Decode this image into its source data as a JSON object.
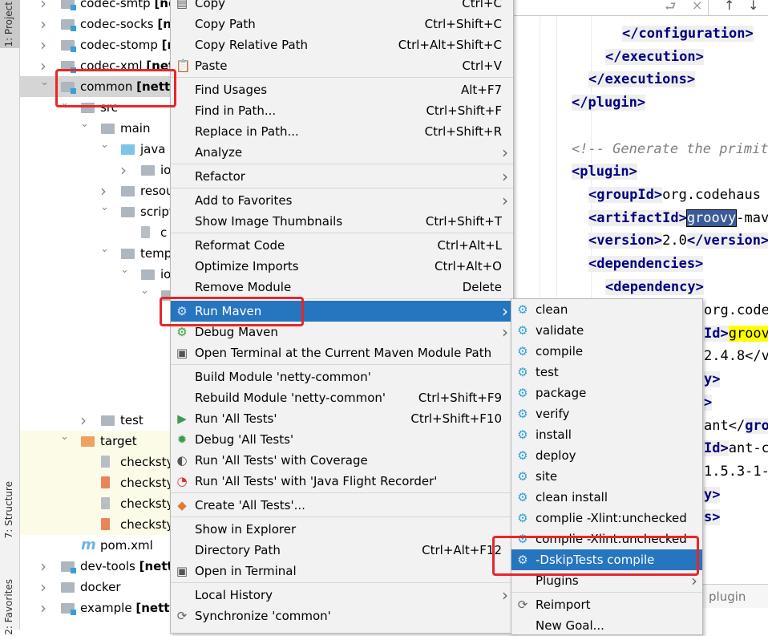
{
  "tool_windows": {
    "project": "1: Project",
    "structure": "7: Structure",
    "favorites": "2: Favorites"
  },
  "tree": [
    {
      "row": 0,
      "indent": 0,
      "chev": "right",
      "icon": "module-folder",
      "name": "codec-smtp",
      "tag": "[netty-codec-smtp]"
    },
    {
      "row": 1,
      "indent": 0,
      "chev": "right",
      "icon": "module-folder",
      "name": "codec-socks",
      "tag": "[netty-codec-socks]"
    },
    {
      "row": 2,
      "indent": 0,
      "chev": "right",
      "icon": "module-folder",
      "name": "codec-stomp",
      "tag": "[netty-codec-stomp]"
    },
    {
      "row": 3,
      "indent": 0,
      "chev": "right",
      "icon": "module-folder",
      "name": "codec-xml",
      "tag": "[netty-codec-xml]"
    },
    {
      "row": 4,
      "indent": 0,
      "chev": "down",
      "icon": "module-folder",
      "name": "common",
      "tag": "[netty-common]",
      "selected": true
    },
    {
      "row": 5,
      "indent": 1,
      "chev": "down",
      "icon": "folder",
      "name": "src"
    },
    {
      "row": 6,
      "indent": 2,
      "chev": "down",
      "icon": "folder",
      "name": "main"
    },
    {
      "row": 7,
      "indent": 3,
      "chev": "down",
      "icon": "source-folder",
      "name": "java"
    },
    {
      "row": 8,
      "indent": 4,
      "chev": "right",
      "icon": "package",
      "name": "io"
    },
    {
      "row": 9,
      "indent": 3,
      "chev": "right",
      "icon": "resources-folder",
      "name": "resources"
    },
    {
      "row": 10,
      "indent": 3,
      "chev": "down",
      "icon": "folder",
      "name": "script"
    },
    {
      "row": 11,
      "indent": 4,
      "chev": "",
      "icon": "groovy-file",
      "name": "c"
    },
    {
      "row": 12,
      "indent": 3,
      "chev": "down",
      "icon": "folder",
      "name": "templates"
    },
    {
      "row": 13,
      "indent": 4,
      "chev": "down",
      "icon": "package",
      "name": "io"
    },
    {
      "row": 14,
      "indent": 5,
      "chev": "down",
      "icon": "folder",
      "name": ""
    },
    {
      "row": 20,
      "indent": 2,
      "chev": "right",
      "icon": "folder",
      "name": "test"
    },
    {
      "row": 21,
      "indent": 1,
      "chev": "down",
      "icon": "excluded-folder",
      "name": "target",
      "yellow": true
    },
    {
      "row": 22,
      "indent": 2,
      "chev": "",
      "icon": "text-file",
      "name": "checkstyle",
      "yellow": true
    },
    {
      "row": 23,
      "indent": 2,
      "chev": "",
      "icon": "xml-file",
      "name": "checkstyle",
      "yellow": true
    },
    {
      "row": 24,
      "indent": 2,
      "chev": "",
      "icon": "text-file",
      "name": "checkstyle",
      "yellow": true
    },
    {
      "row": 25,
      "indent": 2,
      "chev": "",
      "icon": "xml-file",
      "name": "checkstyle",
      "yellow": true
    },
    {
      "row": 26,
      "indent": 1,
      "chev": "",
      "icon": "maven-file",
      "name": "pom.xml"
    },
    {
      "row": 27,
      "indent": 0,
      "chev": "right",
      "icon": "module-folder",
      "name": "dev-tools",
      "tag": "[netty-dev-tools]"
    },
    {
      "row": 28,
      "indent": 0,
      "chev": "right",
      "icon": "folder",
      "name": "docker"
    },
    {
      "row": 29,
      "indent": 0,
      "chev": "right",
      "icon": "module-folder",
      "name": "example",
      "tag": "[netty-example]"
    }
  ],
  "context_menu": [
    {
      "label": "Copy",
      "shortcut": "Ctrl+C",
      "icon": "copy-icon"
    },
    {
      "label": "Copy Path",
      "shortcut": "Ctrl+Shift+C"
    },
    {
      "label": "Copy Relative Path",
      "shortcut": "Ctrl+Alt+Shift+C"
    },
    {
      "label": "Paste",
      "shortcut": "Ctrl+V",
      "icon": "paste-icon"
    },
    {
      "sep": true
    },
    {
      "label": "Find Usages",
      "shortcut": "Alt+F7"
    },
    {
      "label": "Find in Path...",
      "shortcut": "Ctrl+Shift+F"
    },
    {
      "label": "Replace in Path...",
      "shortcut": "Ctrl+Shift+R"
    },
    {
      "label": "Analyze",
      "submenu": true
    },
    {
      "sep": true
    },
    {
      "label": "Refactor",
      "submenu": true
    },
    {
      "sep": true
    },
    {
      "label": "Add to Favorites",
      "submenu": true
    },
    {
      "label": "Show Image Thumbnails",
      "shortcut": "Ctrl+Shift+T"
    },
    {
      "sep": true
    },
    {
      "label": "Reformat Code",
      "shortcut": "Ctrl+Alt+L"
    },
    {
      "label": "Optimize Imports",
      "shortcut": "Ctrl+Alt+O"
    },
    {
      "label": "Remove Module",
      "shortcut": "Delete"
    },
    {
      "sep": true
    },
    {
      "label": "Run Maven",
      "submenu": true,
      "icon": "maven-gear-icon",
      "highlighted": true
    },
    {
      "label": "Debug Maven",
      "submenu": true,
      "icon": "maven-debug-icon"
    },
    {
      "label": "Open Terminal at the Current Maven Module Path",
      "icon": "terminal-icon"
    },
    {
      "sep": true
    },
    {
      "label": "Build Module 'netty-common'"
    },
    {
      "label": "Rebuild Module 'netty-common'",
      "shortcut": "Ctrl+Shift+F9"
    },
    {
      "label": "Run 'All Tests'",
      "shortcut": "Ctrl+Shift+F10",
      "icon": "run-icon"
    },
    {
      "label": "Debug 'All Tests'",
      "icon": "debug-icon"
    },
    {
      "label": "Run 'All Tests' with Coverage",
      "icon": "coverage-icon"
    },
    {
      "label": "Run 'All Tests' with 'Java Flight Recorder'",
      "icon": "profiler-icon"
    },
    {
      "sep": true
    },
    {
      "label": "Create 'All Tests'...",
      "icon": "create-config-icon"
    },
    {
      "sep": true
    },
    {
      "label": "Show in Explorer"
    },
    {
      "label": "Directory Path",
      "shortcut": "Ctrl+Alt+F12"
    },
    {
      "label": "Open in Terminal",
      "icon": "terminal-icon"
    },
    {
      "sep": true
    },
    {
      "label": "Local History",
      "submenu": true
    },
    {
      "label": "Synchronize 'common'",
      "icon": "sync-icon"
    }
  ],
  "maven_submenu": [
    {
      "label": "clean",
      "icon": "gear"
    },
    {
      "label": "validate",
      "icon": "gear"
    },
    {
      "label": "compile",
      "icon": "gear"
    },
    {
      "label": "test",
      "icon": "gear"
    },
    {
      "label": "package",
      "icon": "gear"
    },
    {
      "label": "verify",
      "icon": "gear"
    },
    {
      "label": "install",
      "icon": "gear"
    },
    {
      "label": "deploy",
      "icon": "gear"
    },
    {
      "label": "site",
      "icon": "gear"
    },
    {
      "label": "clean install",
      "icon": "gear"
    },
    {
      "label": "complie -Xlint:unchecked",
      "icon": "gear"
    },
    {
      "label": "complie -Xlint:unchecked",
      "icon": "gear"
    },
    {
      "label": "-DskipTests compile",
      "icon": "gear",
      "highlighted": true
    },
    {
      "label": "Plugins",
      "submenu": true
    },
    {
      "sep": true
    },
    {
      "label": "Reimport",
      "icon": "sync"
    },
    {
      "label": "New Goal..."
    }
  ],
  "editor": {
    "lines": [
      {
        "indent": 3,
        "parts": [
          [
            "tg",
            "</configuration>"
          ]
        ]
      },
      {
        "indent": 2,
        "parts": [
          [
            "tg",
            "</execution>"
          ]
        ]
      },
      {
        "indent": 1,
        "parts": [
          [
            "tg",
            "</executions>"
          ]
        ]
      },
      {
        "indent": 0,
        "parts": [
          [
            "tg",
            "</plugin>"
          ]
        ]
      },
      {
        "indent": 0,
        "parts": []
      },
      {
        "indent": 0,
        "parts": [
          [
            "cm",
            "<!-- Generate the primitive"
          ]
        ]
      },
      {
        "indent": 0,
        "parts": [
          [
            "tg",
            "<plugin>"
          ]
        ]
      },
      {
        "indent": 1,
        "parts": [
          [
            "tg",
            "<groupId>"
          ],
          [
            "",
            "org.codehaus"
          ]
        ]
      },
      {
        "indent": 1,
        "parts": [
          [
            "tg",
            "<artifactId>"
          ],
          [
            "hl",
            "groovy"
          ],
          [
            "",
            "-maven"
          ]
        ]
      },
      {
        "indent": 1,
        "parts": [
          [
            "tg",
            "<version>"
          ],
          [
            "",
            "2.0"
          ],
          [
            "tg",
            "</version>"
          ]
        ]
      },
      {
        "indent": 1,
        "parts": [
          [
            "tg",
            "<dependencies>"
          ]
        ]
      },
      {
        "indent": 2,
        "parts": [
          [
            "tg",
            "<dependency>"
          ]
        ]
      }
    ],
    "fragments": [
      [
        [
          "",
          "org.code"
        ]
      ],
      [
        [
          "tg",
          "Id>"
        ],
        [
          "yl",
          "groovy"
        ]
      ],
      [
        [
          "",
          "2.4.8</v"
        ]
      ],
      [
        [
          "tg",
          "y>"
        ]
      ],
      [
        [
          "tg",
          ">"
        ]
      ],
      [
        [
          "",
          "ant</"
        ],
        [
          "tg",
          "gro"
        ]
      ],
      [
        [
          "tg",
          "Id>"
        ],
        [
          "",
          "ant-c"
        ]
      ],
      [
        [
          "",
          "1.5.3-1-"
        ]
      ],
      [
        [
          "tg",
          "y>"
        ]
      ],
      [
        [
          "tg",
          "s>"
        ]
      ]
    ],
    "breadcrumb": "plugin"
  }
}
